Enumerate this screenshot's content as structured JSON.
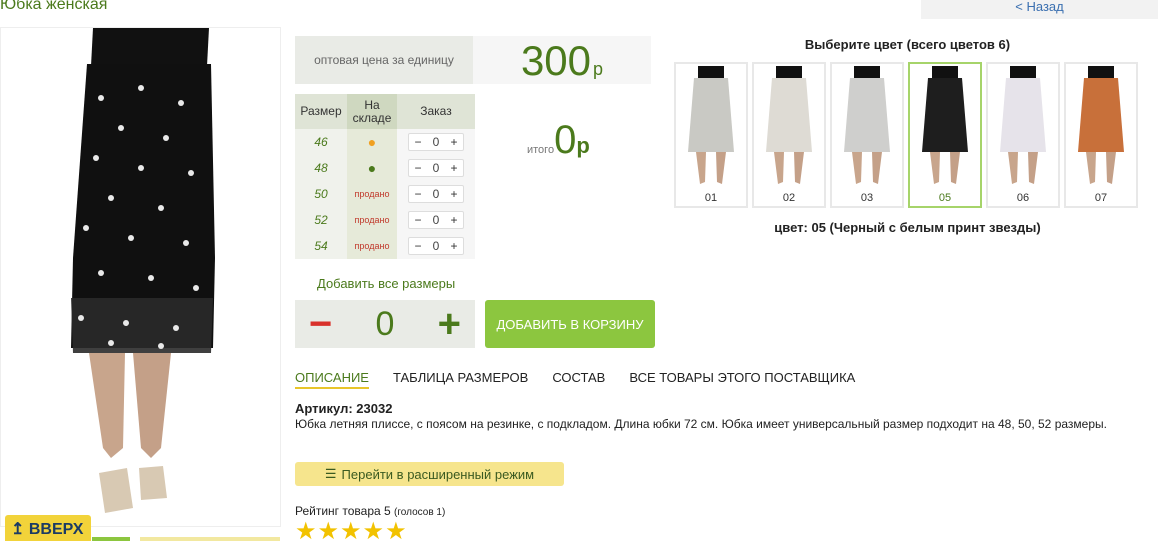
{
  "page": {
    "title": "Юбка женская",
    "back_label": "< Назад"
  },
  "price": {
    "label": "оптовая цена за единицу",
    "value": "300",
    "currency": "р"
  },
  "size_table": {
    "headers": {
      "size": "Размер",
      "stock": "На складе",
      "order": "Заказ"
    },
    "rows": [
      {
        "size": "46",
        "stock": "●",
        "stock_type": "orange-dot",
        "qty": "0"
      },
      {
        "size": "48",
        "stock": "●",
        "stock_type": "green-dot",
        "qty": "0"
      },
      {
        "size": "50",
        "stock": "продано",
        "stock_type": "sold",
        "qty": "0"
      },
      {
        "size": "52",
        "stock": "продано",
        "stock_type": "sold",
        "qty": "0"
      },
      {
        "size": "54",
        "stock": "продано",
        "stock_type": "sold",
        "qty": "0"
      }
    ],
    "minus": "−",
    "plus": "+"
  },
  "total": {
    "label": "итого",
    "value": "0",
    "currency": "р"
  },
  "order": {
    "add_all_label": "Добавить все размеры",
    "qty": "0",
    "minus": "−",
    "plus": "+",
    "add_to_cart_label": "ДОБАВИТЬ В КОРЗИНУ"
  },
  "tabs": [
    {
      "label": "ОПИСАНИЕ",
      "active": true
    },
    {
      "label": "ТАБЛИЦА РАЗМЕРОВ"
    },
    {
      "label": "СОСТАВ"
    },
    {
      "label": "ВСЕ ТОВАРЫ ЭТОГО ПОСТАВЩИКА"
    }
  ],
  "description": {
    "article": "Артикул: 23032",
    "text": "Юбка летняя плиссе, с поясом на резинке, с подкладом. Длина юбки 72 см. Юбка имеет универсальный размер подходит на 48, 50, 52 размеры.",
    "advanced_mode_label": "Перейти в расширенный режим",
    "rating_label": "Рейтинг товара 5",
    "rating_votes": "(голосов 1)",
    "rating_value": 5
  },
  "colors": {
    "title": "Выберите цвет (всего цветов 6)",
    "swatches": [
      {
        "label": "01",
        "pattern": "#c9c9c4"
      },
      {
        "label": "02",
        "pattern": "#dedbd4"
      },
      {
        "label": "03",
        "pattern": "#cfcfcd"
      },
      {
        "label": "05",
        "pattern": "#1e1e1e",
        "selected": true
      },
      {
        "label": "06",
        "pattern": "#e6e3ea"
      },
      {
        "label": "07",
        "pattern": "#c8703a"
      }
    ],
    "current": "цвет: 05 (Черный с белым принт звезды)"
  },
  "scroll_up_label": "↥ ВВЕРХ"
}
